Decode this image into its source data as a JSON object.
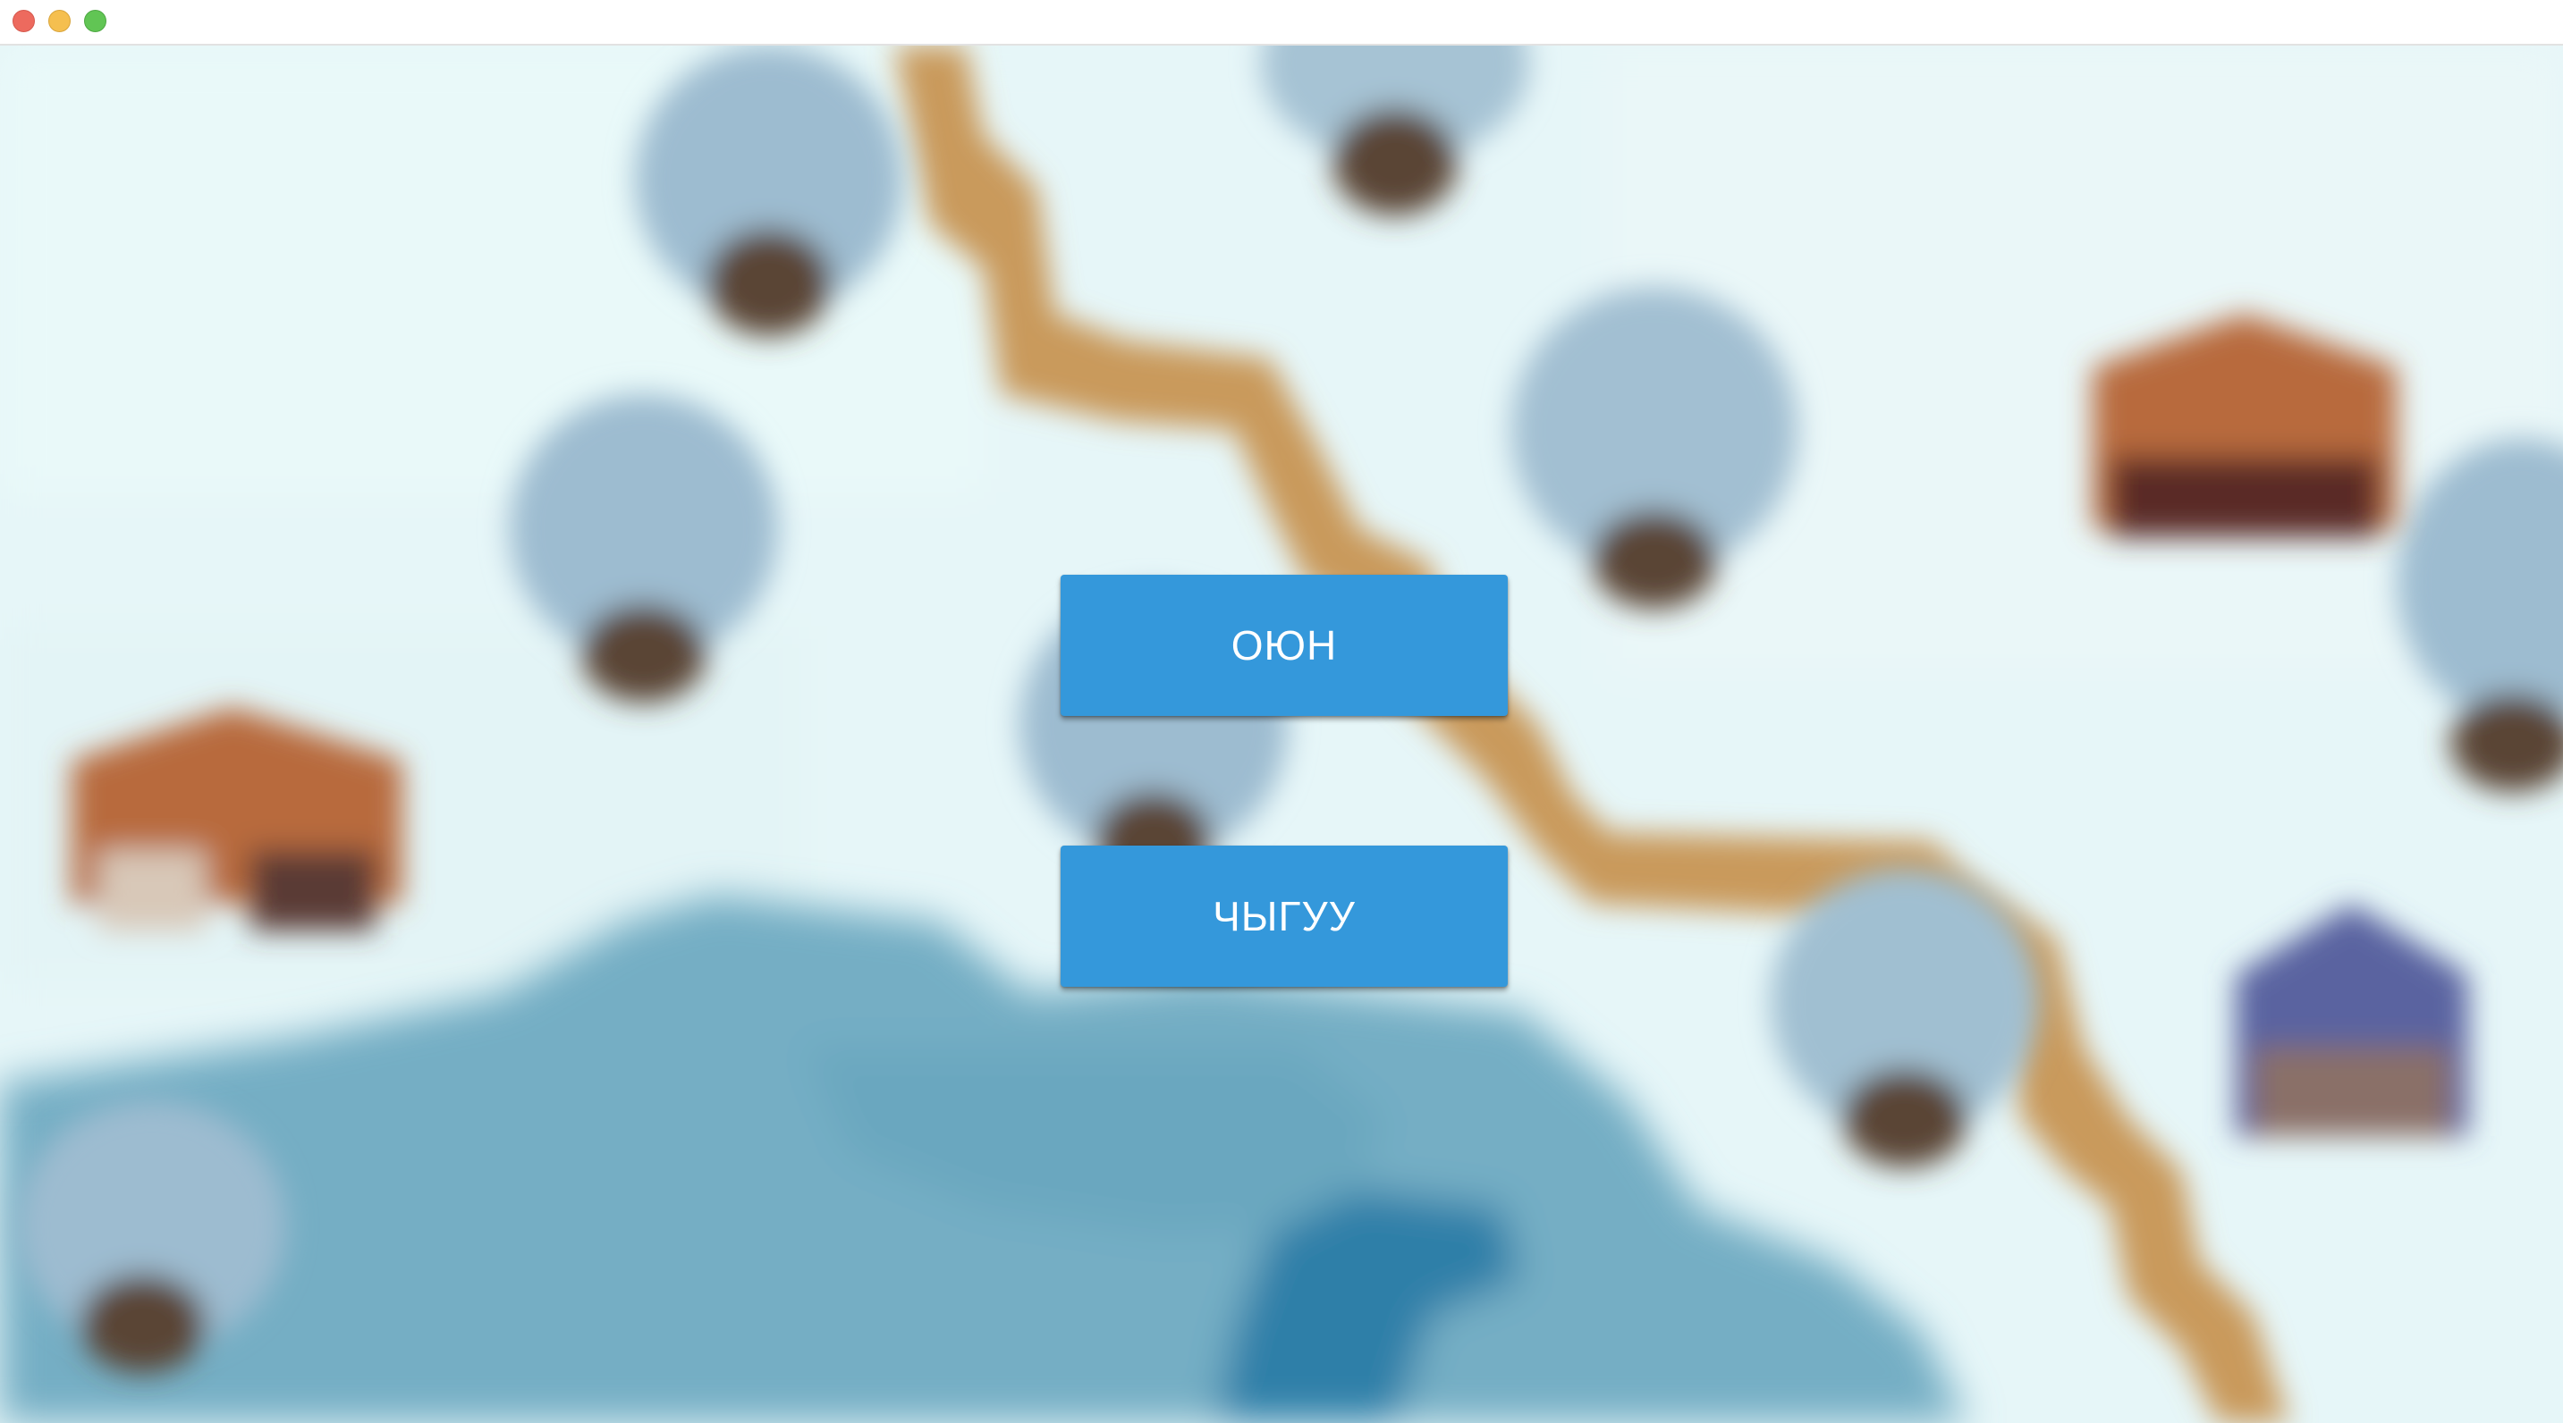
{
  "window": {
    "controls": {
      "close_color": "#ed6a5e",
      "minimize_color": "#f5bf4f",
      "zoom_color": "#61c554"
    }
  },
  "main_menu": {
    "play_label": "ОЮН",
    "exit_label": "ЧЫГУУ",
    "button_color": "#3498db",
    "text_color": "#ffffff"
  },
  "background": {
    "description_style": "blurred winter game map",
    "colors": {
      "snow": "#e6f6f8",
      "water": "#74aec4",
      "deep_water": "#2f7fa8",
      "path": "#c99a5c",
      "tree": "#9dbcd0",
      "trunk": "#5a4435",
      "house_roof": "#b86a3e",
      "house_roof_blue": "#5a63a0"
    }
  }
}
